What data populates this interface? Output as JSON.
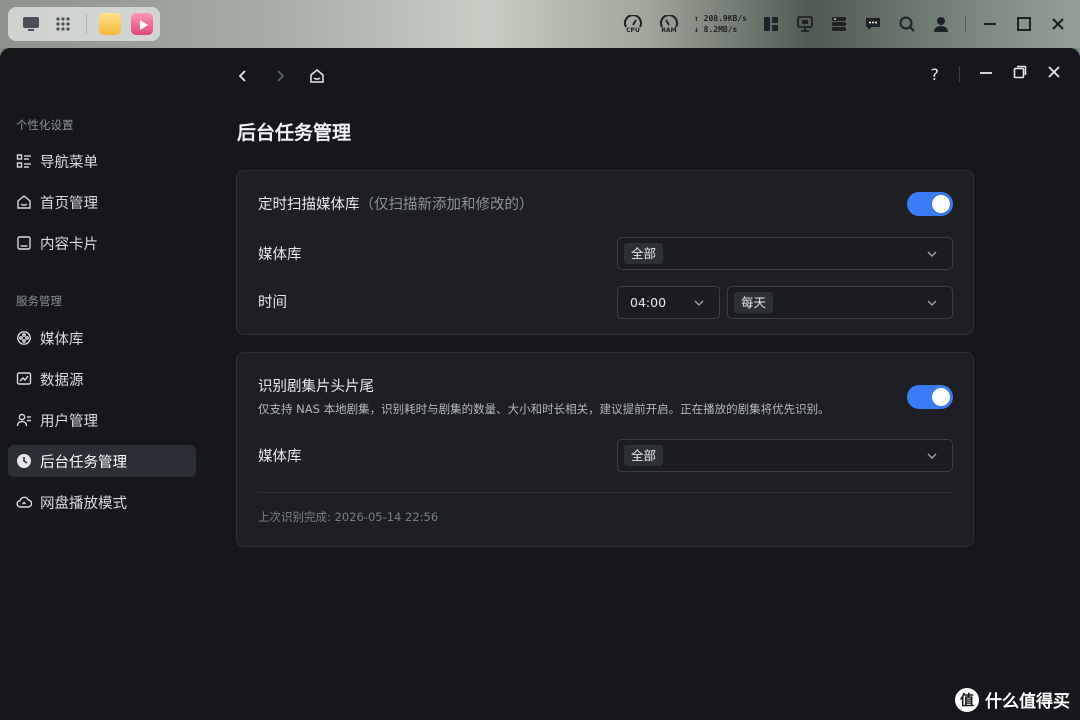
{
  "taskbar": {
    "cpu_label": "CPU",
    "ram_label": "RAM",
    "upload_speed": "208.9KB/s",
    "download_speed": "8.2MB/s",
    "icons_left": [
      "monitor-icon",
      "grid-icon",
      "folder-app-icon",
      "video-app-icon"
    ],
    "icons_right": [
      "layout-icon",
      "display-icon",
      "storage-icon",
      "chat-icon",
      "search-icon",
      "user-icon",
      "minimize-icon",
      "maximize-icon",
      "close-icon"
    ]
  },
  "topnav": {
    "back_icon": "chevron-left-icon",
    "forward_icon": "chevron-right-icon",
    "home_icon": "home-icon",
    "help_label": "?"
  },
  "sidebar": {
    "section1_title": "个性化设置",
    "section2_title": "服务管理",
    "items": [
      {
        "label": "导航菜单",
        "icon": "menu-list-icon"
      },
      {
        "label": "首页管理",
        "icon": "home-icon"
      },
      {
        "label": "内容卡片",
        "icon": "card-icon"
      },
      {
        "label": "媒体库",
        "icon": "film-reel-icon"
      },
      {
        "label": "数据源",
        "icon": "chart-icon"
      },
      {
        "label": "用户管理",
        "icon": "users-icon"
      },
      {
        "label": "后台任务管理",
        "icon": "clock-icon",
        "active": true
      },
      {
        "label": "网盘播放模式",
        "icon": "cloud-icon"
      }
    ]
  },
  "main": {
    "title": "后台任务管理",
    "panel1": {
      "title": "定时扫描媒体库",
      "hint": "（仅扫描新添加和修改的）",
      "toggle_on": true,
      "library_label": "媒体库",
      "library_value": "全部",
      "time_label": "时间",
      "time_value": "04:00",
      "frequency_value": "每天"
    },
    "panel2": {
      "title": "识别剧集片头片尾",
      "description": "仅支持 NAS 本地剧集，识别耗时与剧集的数量、大小和时长相关，建议提前开启。正在播放的剧集将优先识别。",
      "toggle_on": true,
      "library_label": "媒体库",
      "library_value": "全部",
      "last_completed": "上次识别完成: 2026-05-14 22:56"
    }
  },
  "watermark": {
    "logo_char": "值",
    "text": "什么值得买"
  },
  "colors": {
    "accent": "#3b7cf6",
    "window_bg": "#15171b",
    "panel_bg": "#1d1f24"
  }
}
